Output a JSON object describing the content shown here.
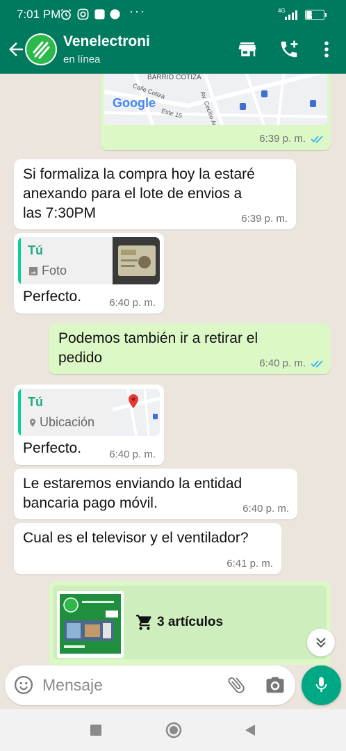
{
  "status_bar": {
    "time": "7:01 PM",
    "network": "4G",
    "battery": "31",
    "battery_level": 0.31
  },
  "header": {
    "contact_name": "Venelectroni",
    "contact_status": "en línea",
    "icons": [
      "back-arrow-icon",
      "store-icon",
      "add-call-icon",
      "more-vert-icon"
    ]
  },
  "messages": [
    {
      "id": "m0",
      "direction": "out",
      "type": "location-map",
      "map_labels": [
        "BARRIO COTIZA",
        "Calle Cotiza",
        "Este 15",
        "Av. Cecilio Acosta",
        "Google"
      ],
      "time": "6:39 p. m.",
      "status": "read"
    },
    {
      "id": "m1",
      "direction": "in",
      "lines": [
        "Si formaliza la compra hoy la estaré",
        "anexando para el lote de envios a",
        "las 7:30PM"
      ],
      "time": "6:39 p. m."
    },
    {
      "id": "m2",
      "direction": "in",
      "quote": {
        "author": "Tú",
        "type": "Foto"
      },
      "text": "Perfecto.",
      "time": "6:40 p. m."
    },
    {
      "id": "m3",
      "direction": "out",
      "lines": [
        "Podemos también ir a retirar el",
        "pedido"
      ],
      "time": "6:40 p. m.",
      "status": "read"
    },
    {
      "id": "m4",
      "direction": "in",
      "quote": {
        "author": "Tú",
        "type": "Ubicación"
      },
      "text": "Perfecto.",
      "time": "6:40 p. m."
    },
    {
      "id": "m5",
      "direction": "in",
      "lines": [
        "Le estaremos enviando la entidad",
        "bancaria pago móvil."
      ],
      "time": "6:40 p. m."
    },
    {
      "id": "m6",
      "direction": "in",
      "lines": [
        "Cual es el televisor y el ventilador?"
      ],
      "time": "6:41 p. m."
    },
    {
      "id": "m7",
      "direction": "out",
      "type": "cart",
      "cart_label": "3 artículos"
    }
  ],
  "input": {
    "placeholder": "Mensaje",
    "value": ""
  },
  "colors": {
    "header": "#007a5e",
    "outgoing_bubble": "#dcf8c6",
    "incoming_bubble": "#ffffff",
    "accent": "#00a884",
    "read_ticks": "#34b7f1"
  }
}
